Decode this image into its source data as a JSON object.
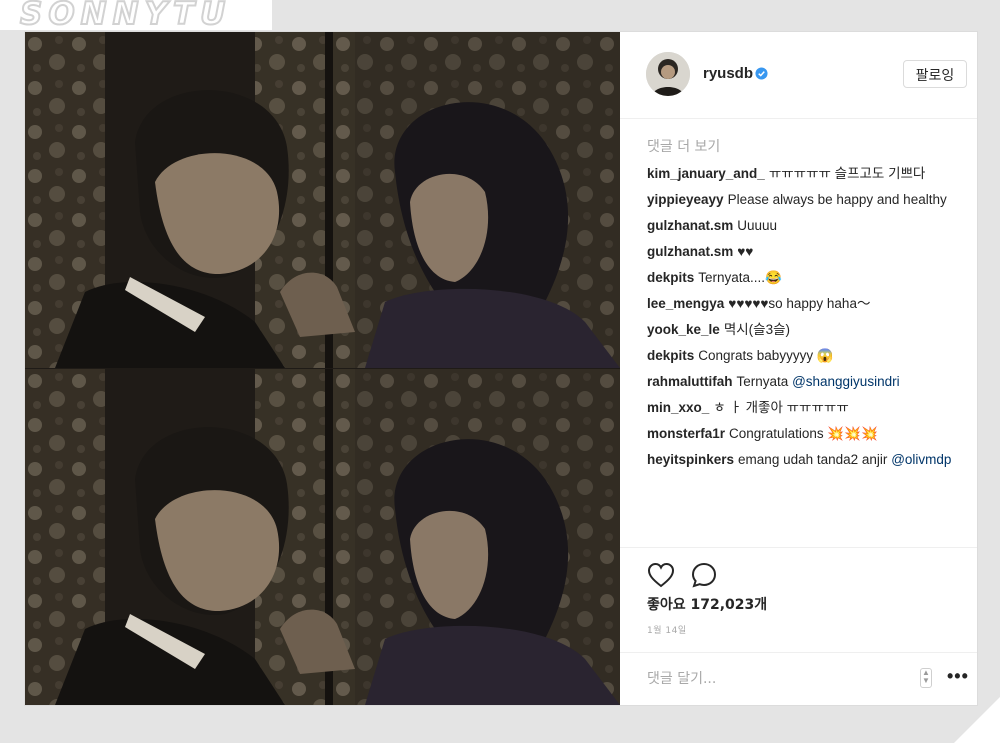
{
  "watermark": {
    "text": "SONNYTU"
  },
  "post": {
    "username": "ryusdb",
    "follow_label": "팔로잉",
    "view_more_label": "댓글 더 보기",
    "comments": [
      {
        "user": "kim_january_and_",
        "text": "ㅠㅠㅠㅠㅠ 슬프고도 기쁘다"
      },
      {
        "user": "yippieyeayy",
        "text": "Please always be happy and healthy"
      },
      {
        "user": "gulzhanat.sm",
        "text": "Uuuuu"
      },
      {
        "user": "gulzhanat.sm",
        "text": "♥♥"
      },
      {
        "user": "dekpits",
        "text": "Ternyata....😂"
      },
      {
        "user": "lee_mengya",
        "text": "♥♥♥♥♥so happy haha～"
      },
      {
        "user": "yook_ke_le",
        "text": "멱시(슬3슬)"
      },
      {
        "user": "dekpits",
        "text": "Congrats babyyyyy 😱"
      },
      {
        "user": "rahmaluttifah",
        "text": "Ternyata",
        "mention": "@shanggiyusindri"
      },
      {
        "user": "min_xxo_",
        "text": "ㅎ ㅏ 개좋아 ㅠㅠㅠㅠㅠ"
      },
      {
        "user": "monsterfa1r",
        "text": "Congratulations 💥💥💥"
      },
      {
        "user": "heyitspinkers",
        "text": "emang udah tanda2 anjir",
        "mention": "@olivmdp"
      }
    ],
    "likes_label": "좋아요 172,023개",
    "date": "1월 14일",
    "comment_placeholder": "댓글 달기...",
    "more_options_label": "•••"
  },
  "icons": {
    "verified": "verified-badge-icon",
    "like": "heart-outline-icon",
    "comment": "speech-bubble-icon",
    "more": "ellipsis-icon"
  },
  "colors": {
    "verified_blue": "#3897f0",
    "text_primary": "#262626",
    "text_muted": "#a8a8a8",
    "frame_gray": "#e4e4e4"
  }
}
